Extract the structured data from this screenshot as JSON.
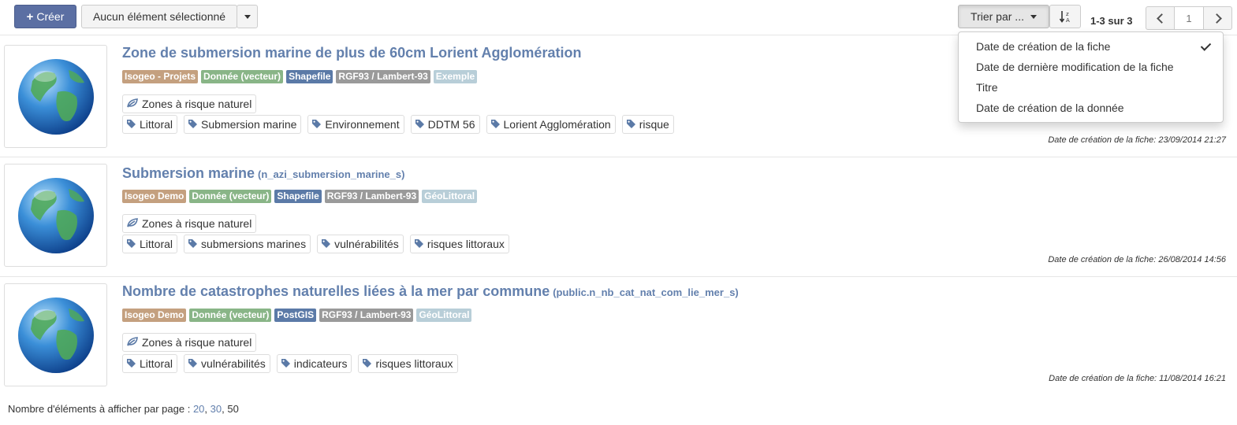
{
  "toolbar": {
    "create_label": "Créer",
    "selection_label": "Aucun élément sélectionné",
    "sort_label": "Trier par ...",
    "order_icon": "sort-alpha-icon",
    "count": "1-3 sur 3",
    "page": "1"
  },
  "sort_menu": {
    "items": [
      "Date de création de la fiche",
      "Date de dernière modification de la fiche",
      "Titre",
      "Date de création de la donnée"
    ],
    "selected": "Date de création de la fiche"
  },
  "results": [
    {
      "title": "Zone de submersion marine de plus de 60cm Lorient Agglomération",
      "subtitle": "",
      "labels": [
        "Isogeo - Projets",
        "Donnée (vecteur)",
        "Shapefile",
        "RGF93 / Lambert-93",
        "Exemple"
      ],
      "theme": "Zones à risque naturel",
      "keywords": [
        "Littoral",
        "Submersion marine",
        "Environnement",
        "DDTM 56",
        "Lorient Agglomération",
        "risque"
      ],
      "date": "Date de création de la fiche: 23/09/2014 21:27"
    },
    {
      "title": "Submersion marine",
      "subtitle": "(n_azi_submersion_marine_s)",
      "labels": [
        "Isogeo Demo",
        "Donnée (vecteur)",
        "Shapefile",
        "RGF93 / Lambert-93",
        "GéoLittoral"
      ],
      "theme": "Zones à risque naturel",
      "keywords": [
        "Littoral",
        "submersions marines",
        "vulnérabilités",
        "risques littoraux"
      ],
      "date": "Date de création de la fiche: 26/08/2014 14:56"
    },
    {
      "title": "Nombre de catastrophes naturelles liées à la mer par commune",
      "subtitle": "(public.n_nb_cat_nat_com_lie_mer_s)",
      "labels": [
        "Isogeo Demo",
        "Donnée (vecteur)",
        "PostGIS",
        "RGF93 / Lambert-93",
        "GéoLittoral"
      ],
      "theme": "Zones à risque naturel",
      "keywords": [
        "Littoral",
        "vulnérabilités",
        "indicateurs",
        "risques littoraux"
      ],
      "date": "Date de création de la fiche: 11/08/2014 16:21"
    }
  ],
  "footer": {
    "prefix": "Nombre d'éléments à afficher par page :",
    "options": [
      "20",
      "30",
      "50"
    ],
    "current": "50"
  },
  "colors": {
    "primary": "#5b6fa3",
    "title": "#6380ad",
    "label_owner": "#c4a07f",
    "label_type": "#89b587",
    "label_format": "#5b7aa7",
    "label_srs": "#9a9a9a",
    "label_catalog": "#b8ced8"
  }
}
